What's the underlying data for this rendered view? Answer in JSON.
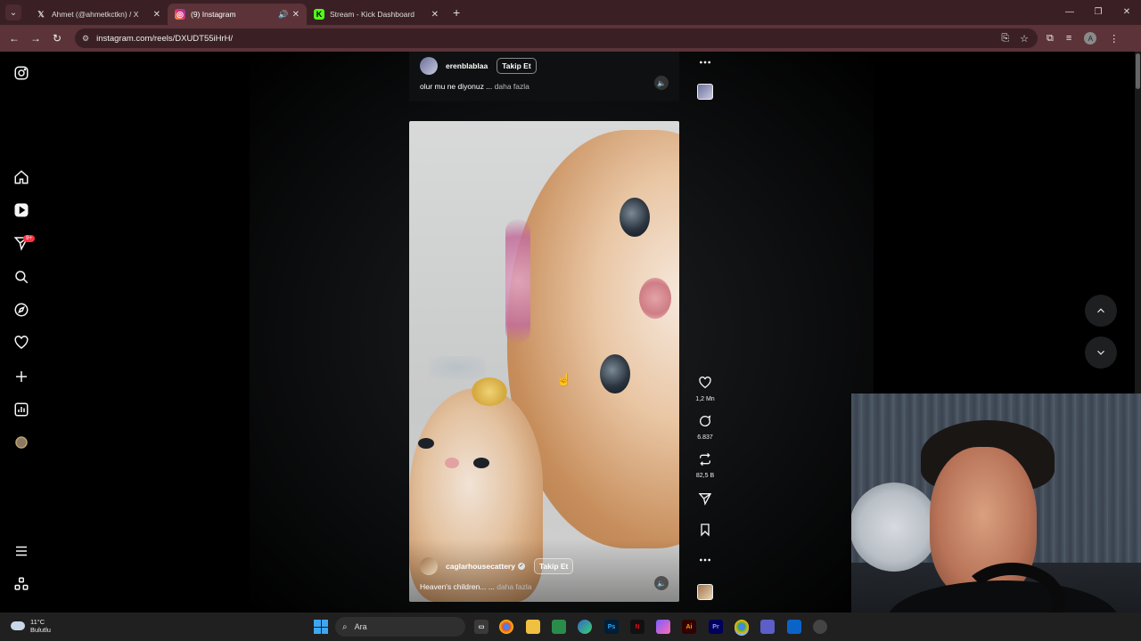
{
  "browser": {
    "tabs": [
      {
        "title": "Ahmet (@ahmetkctkn) / X",
        "icon": "x-logo-icon"
      },
      {
        "title": "(9) Instagram",
        "icon": "instagram-icon",
        "active": true
      },
      {
        "title": "Stream - Kick Dashboard",
        "icon": "kick-icon"
      }
    ],
    "url": "instagram.com/reels/DXUDT55iHrH/",
    "profile_initial": "A"
  },
  "sidebar": {
    "items": [
      "instagram-logo",
      "home",
      "reels",
      "direct-messages",
      "search",
      "explore",
      "notifications",
      "create",
      "dashboard",
      "profile",
      "more",
      "also-from-meta"
    ],
    "notification_badge": "9+"
  },
  "prev_reel": {
    "username": "erenblablaa",
    "follow_label": "Takip Et",
    "caption": "olur mu ne diyonuz ...",
    "more_label": "daha fazla"
  },
  "reel": {
    "username": "caglarhousecattery",
    "follow_label": "Takip Et",
    "caption": "Heaven's children... ...",
    "more_label": "daha fazla",
    "likes": "1,2 Mn",
    "comments": "6.837",
    "reposts": "82,5 B"
  },
  "taskbar": {
    "temperature": "11°C",
    "weather": "Bulutlu",
    "search_placeholder": "Ara"
  }
}
